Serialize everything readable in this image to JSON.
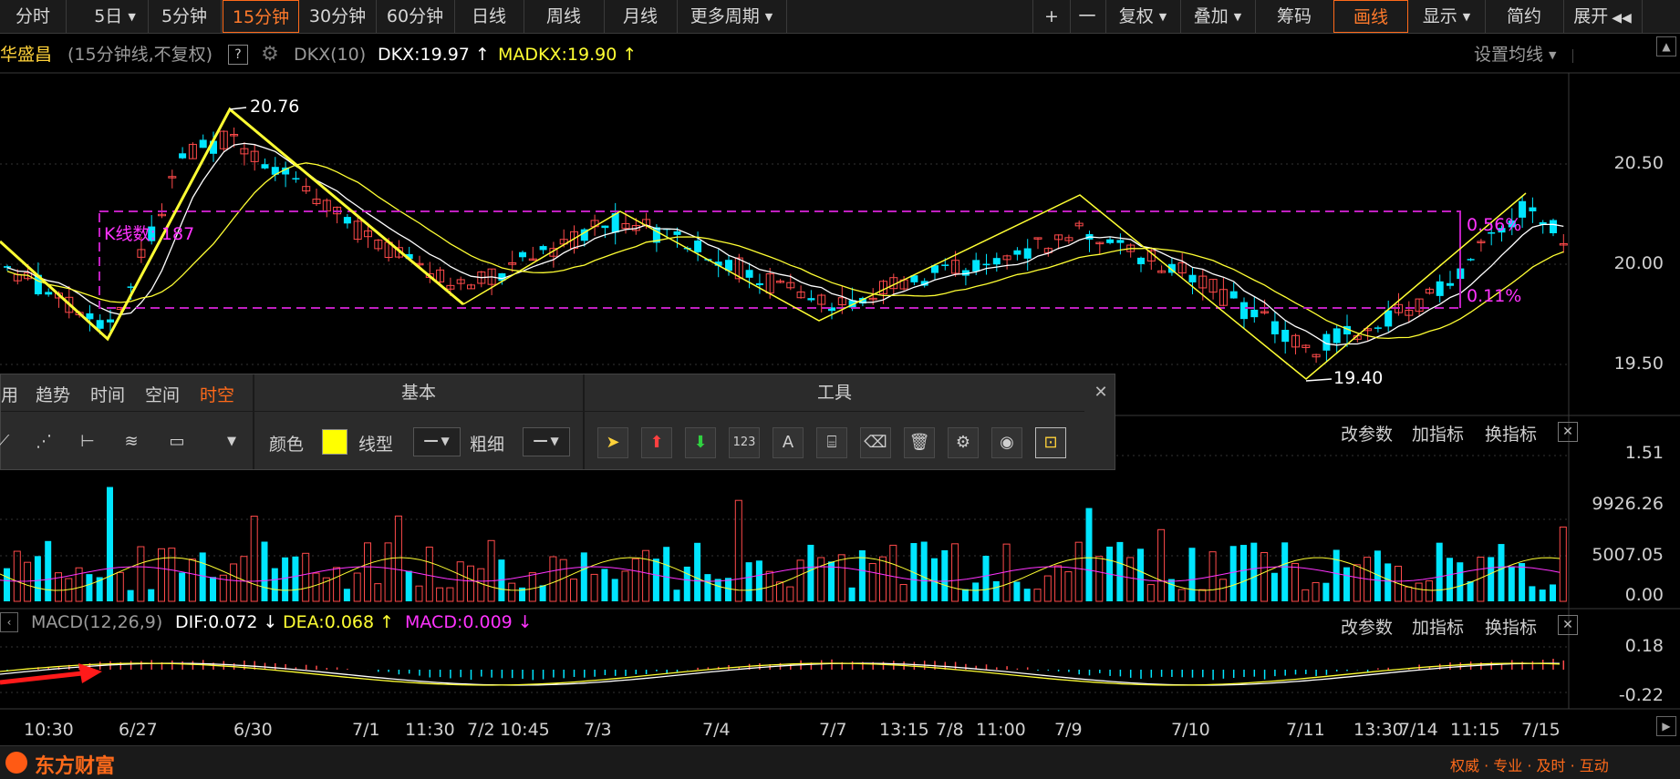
{
  "toolbar": {
    "items": [
      "分时",
      "5日",
      "5分钟",
      "15分钟",
      "30分钟",
      "60分钟",
      "日线",
      "周线",
      "月线",
      "更多周期"
    ],
    "right": [
      "+",
      "一",
      "复权",
      "叠加",
      "筹码",
      "画线",
      "显示",
      "简约",
      "展开"
    ]
  },
  "info": {
    "stock": "华盛昌",
    "period": "(15分钟线,不复权)",
    "help": "?",
    "indicator": "DKX(10)",
    "dkx": "DKX:19.97",
    "madkx": "MADKX:19.90",
    "set_ma": "设置均线"
  },
  "main_chart": {
    "y_labels": [
      "20.50",
      "20.00",
      "19.50"
    ],
    "annotations": {
      "high": "20.76",
      "low": "19.40",
      "kcount": "K线数: 187",
      "pct_top": "0.56%",
      "pct_bottom": "0.11%"
    }
  },
  "volume": {
    "y_labels": [
      "1.51",
      "9926.26",
      "5007.05",
      "0.00"
    ],
    "controls": [
      "改参数",
      "加指标",
      "换指标"
    ]
  },
  "macd": {
    "title": "MACD(12,26,9)",
    "dif": "DIF:0.072",
    "dea": "DEA:0.068",
    "macd": "MACD:0.009",
    "y_labels": [
      "0.18",
      "-0.22"
    ],
    "controls": [
      "改参数",
      "加指标",
      "换指标"
    ]
  },
  "time_axis": [
    "10:30",
    "6/27",
    "6/30",
    "7/1",
    "11:30",
    "7/2",
    "10:45",
    "7/3",
    "7/4",
    "7/7",
    "13:15",
    "7/8",
    "11:00",
    "7/9",
    "7/10",
    "7/11",
    "13:30",
    "7/14",
    "11:15",
    "7/15"
  ],
  "draw_toolbar": {
    "tabs": [
      "用",
      "趋势",
      "时间",
      "空间",
      "时空"
    ],
    "section_basic": "基本",
    "section_tools": "工具",
    "color_label": "颜色",
    "line_label": "线型",
    "width_label": "粗细",
    "color": "#ffff00",
    "close": "✕"
  },
  "footer": {
    "brand": "东方财富",
    "slogan": "权威 · 专业 · 及时 · 互动"
  },
  "colors": {
    "up": "#ff4a4a",
    "down": "#00e5ff",
    "yellow": "#ffff33",
    "magenta": "#ff33ff",
    "accent": "#ff6a1a"
  }
}
